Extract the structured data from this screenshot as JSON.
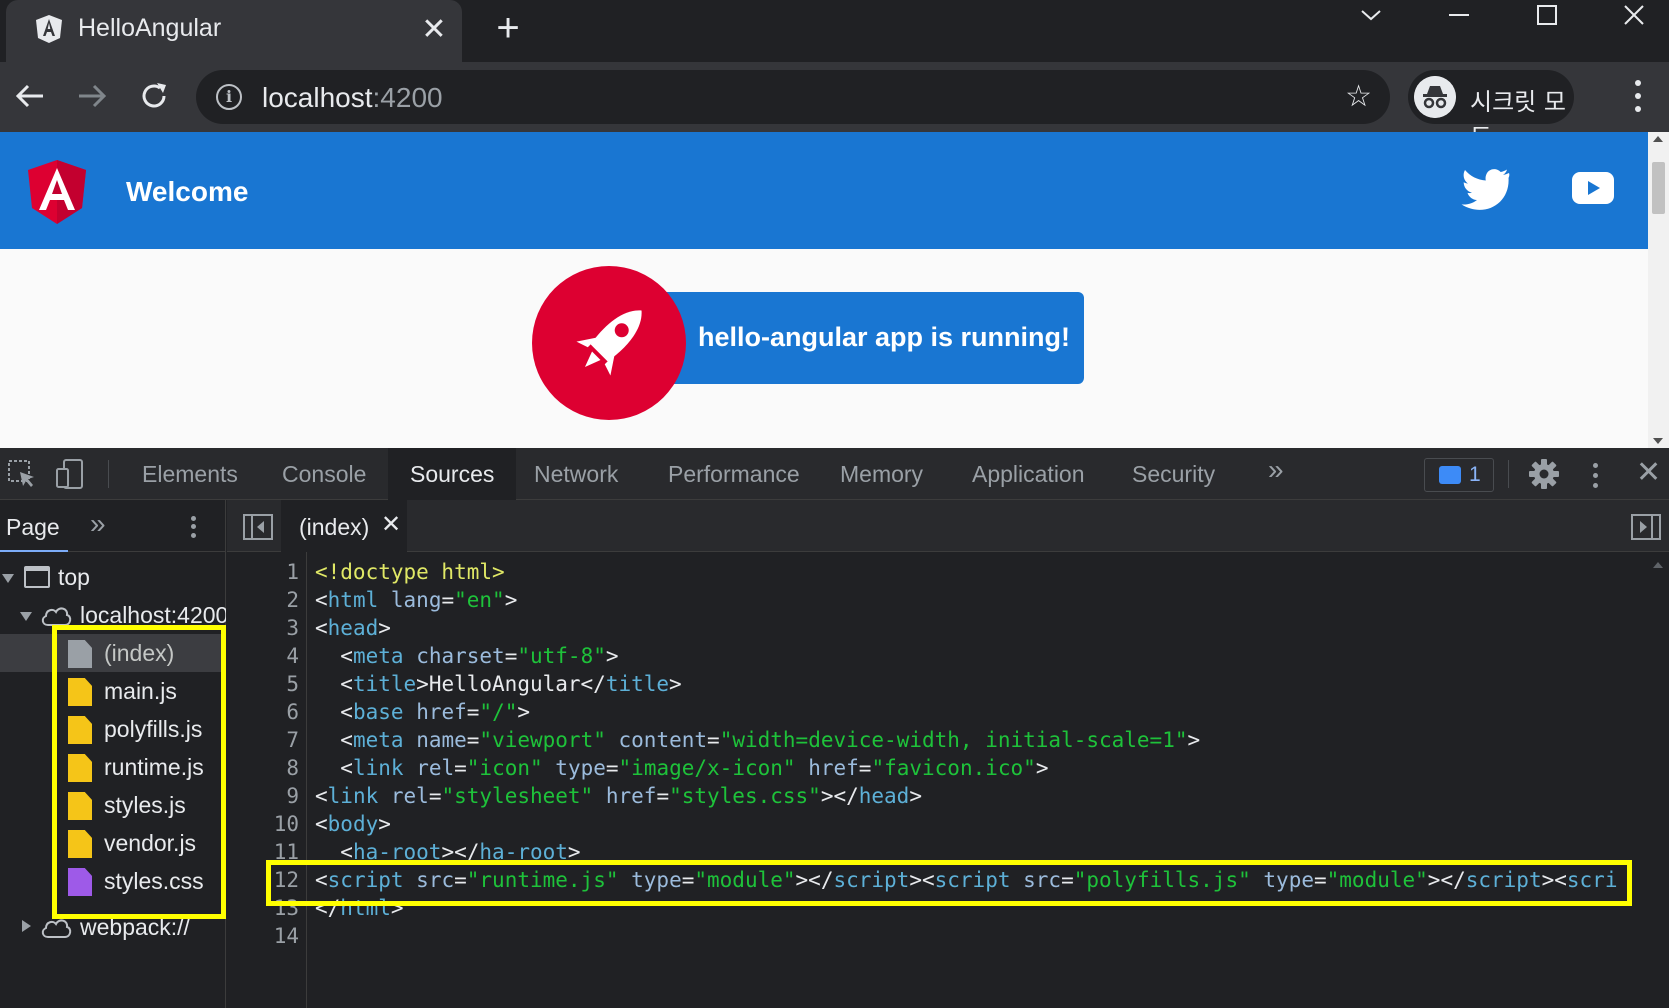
{
  "browser": {
    "tab_title": "HelloAngular",
    "tab_close": "✕",
    "new_tab": "+",
    "url_host": "localhost",
    "url_port": ":4200",
    "incognito_label": "시크릿 모드",
    "info_glyph": "i",
    "star_glyph": "☆"
  },
  "page": {
    "header_title": "Welcome",
    "banner_text": "hello-angular app is running!",
    "colors": {
      "header_bg": "#1976d2",
      "rocket_red": "#dd0031"
    }
  },
  "devtools": {
    "tabs": [
      "Elements",
      "Console",
      "Sources",
      "Network",
      "Performance",
      "Memory",
      "Application",
      "Security"
    ],
    "active_tab": "Sources",
    "more_tabs": "»",
    "issues_count": "1",
    "close": "✕",
    "navigator": {
      "tab_label": "Page",
      "more": "»",
      "tree": {
        "top": "top",
        "host": "localhost:4200",
        "files": [
          {
            "name": "(index)",
            "kind": "html"
          },
          {
            "name": "main.js",
            "kind": "js"
          },
          {
            "name": "polyfills.js",
            "kind": "js"
          },
          {
            "name": "runtime.js",
            "kind": "js"
          },
          {
            "name": "styles.js",
            "kind": "js"
          },
          {
            "name": "vendor.js",
            "kind": "js"
          },
          {
            "name": "styles.css",
            "kind": "css"
          }
        ],
        "webpack": "webpack://"
      }
    },
    "editor": {
      "open_file": "(index)",
      "close": "✕",
      "line_numbers": [
        "1",
        "2",
        "3",
        "4",
        "5",
        "6",
        "7",
        "8",
        "9",
        "10",
        "11",
        "12",
        "13",
        "14"
      ]
    }
  }
}
